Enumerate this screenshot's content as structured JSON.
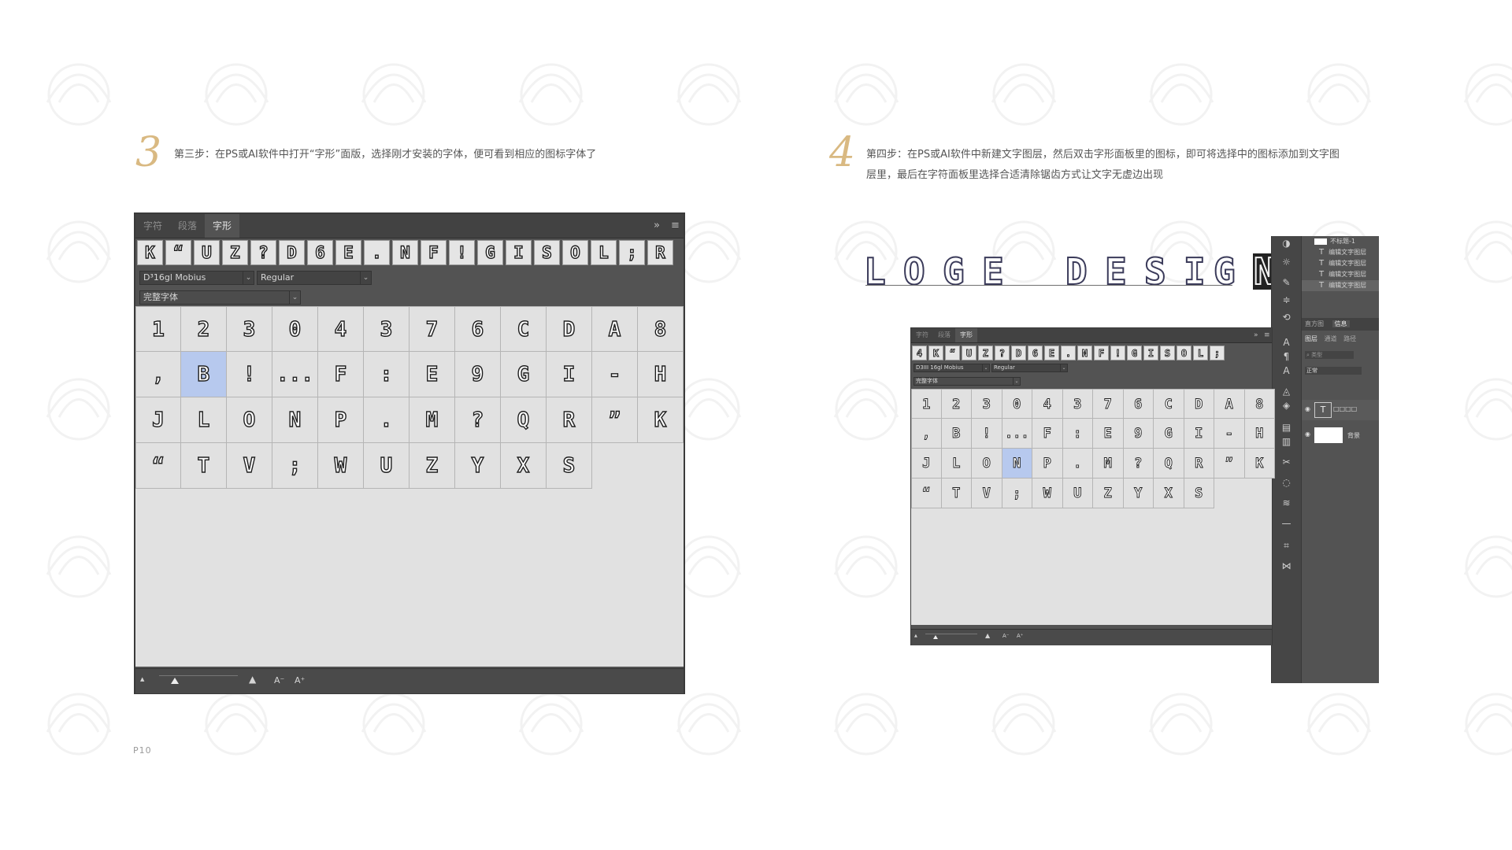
{
  "step3": {
    "number": "3",
    "text": "第三步：在PS或AI软件中打开“字形”面版，选择刚才安装的字体，便可看到相应的图标字体了"
  },
  "step4": {
    "number": "4",
    "text_line1": "第四步：在PS或AI软件中新建文字图层，然后双击字形面板里的图标，即可将选择中的图标添加到文字图",
    "text_line2": "层里，最后在字符面板里选择合适清除锯齿方式让文字无虚边出现"
  },
  "page_number": "P10",
  "panel1": {
    "tabs": [
      "字符",
      "段落",
      "字形"
    ],
    "active_tab": 2,
    "menu_expand": "»",
    "menu_icon": "≡",
    "recent_glyphs": [
      "K",
      "“",
      "U",
      "Z",
      "?",
      "D",
      "6",
      "E",
      ".",
      "N",
      "F",
      "!",
      "G",
      "I",
      "S",
      "O",
      "L",
      ";",
      "R"
    ],
    "font_family": "D³16gl Mobius",
    "font_style": "Regular",
    "subset": "完整字体",
    "glyph_rows": [
      [
        "1",
        "2",
        "3",
        "0",
        "4",
        "3",
        "7",
        "6",
        "C",
        "D",
        "A",
        "8"
      ],
      [
        ",",
        "B",
        "!",
        "...",
        "F",
        ":",
        "E",
        "9",
        "G",
        "I",
        "-",
        "H"
      ],
      [
        "J",
        "L",
        "O",
        "N",
        "P",
        ".",
        "M",
        "?",
        "Q",
        "R",
        "”",
        "K"
      ],
      [
        "“",
        "T",
        "V",
        ";",
        "W",
        "U",
        "Z",
        "Y",
        "X",
        "S"
      ]
    ],
    "selected_glyph": {
      "row": 1,
      "col": 1
    },
    "bottom_icons": {
      "mountain_small": "▲",
      "mountain_large": "▲",
      "text_smaller": "A⁻",
      "text_larger": "A⁺"
    }
  },
  "composite": {
    "logo_text": "LOGE DESIGN",
    "logo_chars": [
      "L",
      "O",
      "G",
      "E",
      " ",
      "D",
      "E",
      "S",
      "I",
      "G",
      "N"
    ],
    "logo_highlight_index": 10,
    "layers": [
      "不标题-1",
      "编辑文字图层",
      "编辑文字图层",
      "编辑文字图层",
      "编辑文字图层"
    ],
    "layer_panel_tabs": [
      "直方图",
      "信息"
    ],
    "layer_panel_subtabs": [
      "图层",
      "通道",
      "路径"
    ],
    "layer_search_placeholder": "类型",
    "blend_mode": "正常",
    "text_layer_label": "T",
    "text_layer_name": "□□□□",
    "background_layer_name": "背景"
  },
  "panel2": {
    "tabs": [
      "字符",
      "段落",
      "字形"
    ],
    "active_tab": 2,
    "menu_expand": "»",
    "menu_icon": "≡",
    "recent_glyphs": [
      "4",
      "K",
      "“",
      "U",
      "Z",
      "?",
      "D",
      "6",
      "E",
      ".",
      "N",
      "F",
      "!",
      "G",
      "I",
      "S",
      "O",
      "L",
      ";"
    ],
    "font_family": "D3III 16gl Mobius",
    "font_style": "Regular",
    "subset": "完整字体",
    "glyph_rows": [
      [
        "1",
        "2",
        "3",
        "0",
        "4",
        "3",
        "7",
        "6",
        "C",
        "D",
        "A",
        "8"
      ],
      [
        ",",
        "B",
        "!",
        "...",
        "F",
        ":",
        "E",
        "9",
        "G",
        "I",
        "-",
        "H"
      ],
      [
        "J",
        "L",
        "O",
        "N",
        "P",
        ".",
        "M",
        "?",
        "Q",
        "R",
        "”",
        "K"
      ],
      [
        "“",
        "T",
        "V",
        ";",
        "W",
        "U",
        "Z",
        "Y",
        "X",
        "S"
      ]
    ],
    "selected_glyph": {
      "row": 2,
      "col": 3
    }
  },
  "colors": {
    "accent_number": "#d9b982",
    "ps_panel": "#535353",
    "ps_tabbar": "#424242",
    "glyph_cell": "#e1e1e1",
    "glyph_selected": "#b7c9ee"
  }
}
